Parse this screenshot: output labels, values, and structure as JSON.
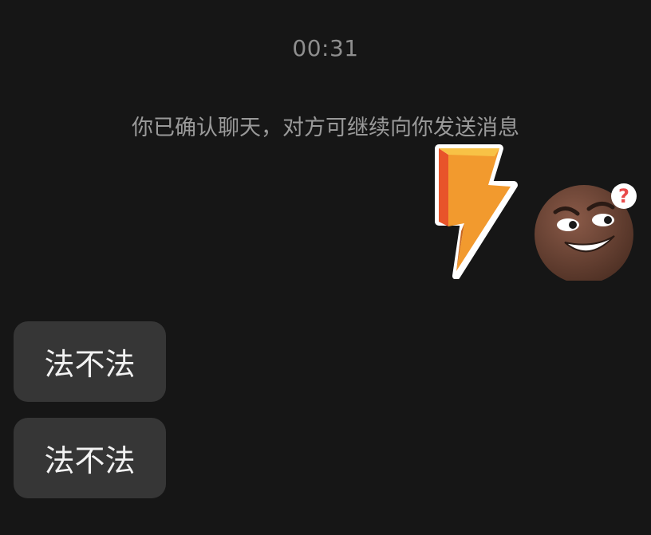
{
  "chat": {
    "timestamp": "00:31",
    "system_notice": "你已确认聊天，对方可继续向你发送消息",
    "outgoing": [
      {
        "type": "sticker",
        "icon": "lightning-sticker-icon"
      }
    ],
    "incoming": [
      {
        "type": "text",
        "text": "法不法"
      },
      {
        "type": "text",
        "text": "法不法"
      }
    ],
    "self_avatar": {
      "icon": "smirking-face-avatar-icon"
    }
  },
  "colors": {
    "background": "#161616",
    "bubble": "#363636",
    "muted_text": "#8e8e8e",
    "message_text": "#f2f2f2",
    "lightning_orange": "#f29a2e",
    "lightning_yellow": "#f8c246",
    "lightning_red": "#e8542a"
  }
}
